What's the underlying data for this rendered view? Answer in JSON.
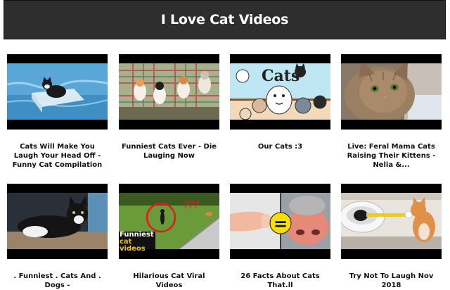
{
  "page": {
    "title": "I Love Cat Videos"
  },
  "videos": [
    {
      "title": "Cats Will Make You Laugh Your Head Off - Funny Cat Compilation",
      "thumb_icon": "cat-in-water-thumbnail"
    },
    {
      "title": "Funniest Cats Ever - Die Lauging Now",
      "thumb_icon": "kittens-on-couch-thumbnail"
    },
    {
      "title": "Our Cats :3",
      "thumb_icon": "cartoon-cats-thumbnail"
    },
    {
      "title": "Live: Feral Mama Cats Raising Their Kittens - Nelia &...",
      "thumb_icon": "kitten-closeup-thumbnail"
    },
    {
      "title": ". Funniest . Cats And . Dogs -",
      "thumb_icon": "tuxedo-cat-thumbnail"
    },
    {
      "title": "Hilarious Cat Viral Videos",
      "thumb_icon": "cat-in-yard-thumbnail",
      "overlay_text": [
        "Funniest",
        "cat videos"
      ],
      "marks": "???"
    },
    {
      "title": "26 Facts About Cats That.ll",
      "thumb_icon": "finger-nose-thumbnail",
      "symbol": "="
    },
    {
      "title": "Try Not To Laugh Nov 2018",
      "thumb_icon": "cat-toilet-thumbnail"
    }
  ]
}
